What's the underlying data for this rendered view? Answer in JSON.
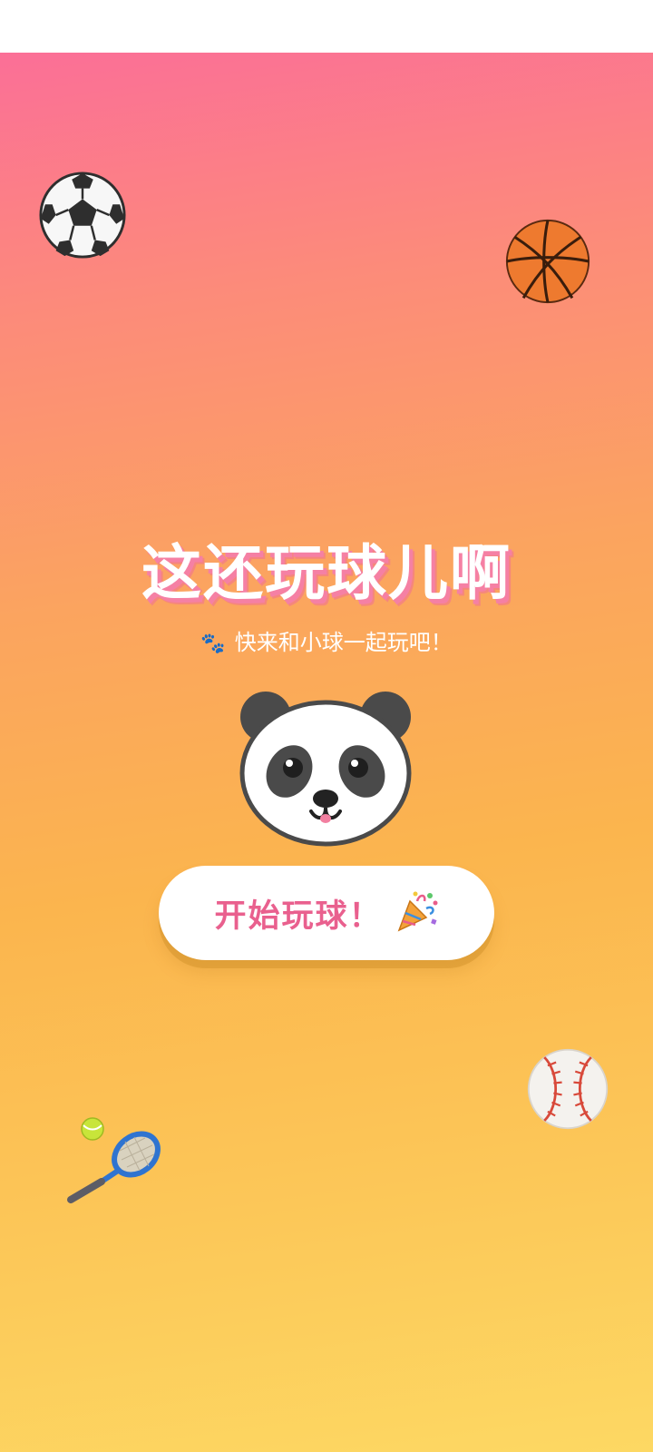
{
  "app": {
    "title": "这还玩球儿啊",
    "subtitle": "快来和小球一起玩吧！",
    "start_button_label": "开始玩球！"
  },
  "icons": {
    "subtitle_icon": "paw-prints-icon",
    "button_icon": "party-popper-icon",
    "mascot": "panda-face",
    "decorations": [
      "soccer-ball-icon",
      "basketball-icon",
      "baseball-icon",
      "tennis-racket-icon"
    ]
  },
  "colors": {
    "gradient_top": "#fb6f97",
    "gradient_bottom": "#fdd863",
    "title_shadow": "#f580a4",
    "button_text": "#e9608e",
    "button_bg": "#ffffff"
  }
}
